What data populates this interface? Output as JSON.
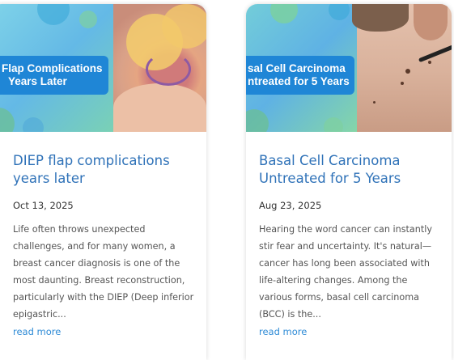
{
  "cards": [
    {
      "image_overlay_text_line1": "Flap Complications",
      "image_overlay_text_line2": "Years Later",
      "title_line1": "DIEP flap complications",
      "title_line2": "years later",
      "date": "Oct 13, 2025",
      "excerpt_lines": [
        "Life often throws unexpected",
        "challenges, and for many women, a",
        "breast cancer diagnosis is one of the",
        "most daunting. Breast reconstruction,",
        "particularly with the DIEP (Deep inferior",
        "epigastric..."
      ],
      "read_more": "read more"
    },
    {
      "image_overlay_text_line1": "sal Cell Carcinoma",
      "image_overlay_text_line2": "ntreated for 5 Years",
      "title_line1": "Basal Cell Carcinoma",
      "title_line2": "Untreated for 5 Years",
      "date": "Aug 23, 2025",
      "excerpt_lines": [
        "Hearing the word cancer can instantly",
        "stir fear and uncertainty. It's natural—",
        "cancer has long been associated with",
        "life-altering changes. Among the",
        "various forms, basal cell carcinoma",
        "(BCC) is the..."
      ],
      "read_more": "read more"
    }
  ],
  "colors": {
    "title": "#2f72b8",
    "link": "#2f8bd6",
    "overlay_label": "#1f86d6",
    "body_text": "#555555"
  }
}
